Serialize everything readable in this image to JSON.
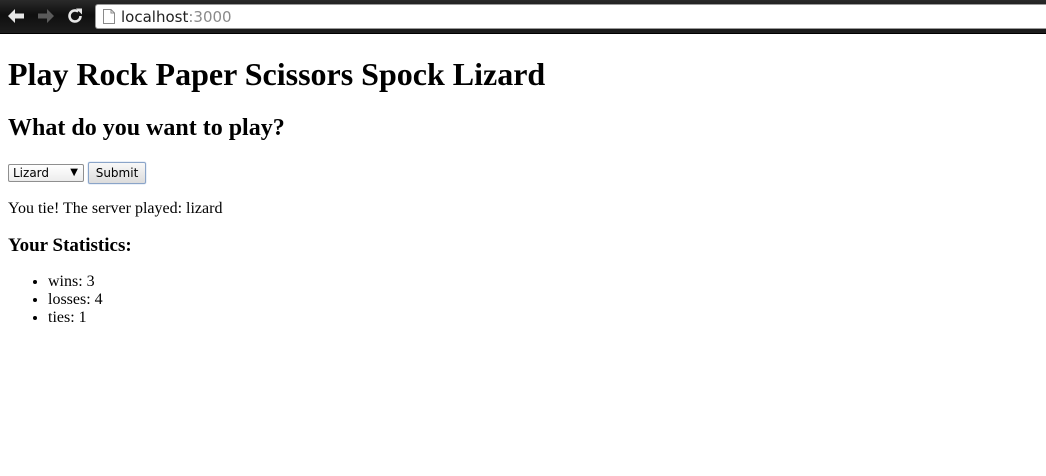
{
  "browser": {
    "url_host": "localhost",
    "url_port": ":3000"
  },
  "page": {
    "title": "Play Rock Paper Scissors Spock Lizard",
    "prompt": "What do you want to play?",
    "select_value": "Lizard",
    "submit_label": "Submit",
    "result_text": "You tie! The server played: lizard",
    "stats_heading": "Your Statistics:",
    "stats": [
      {
        "text": "wins: 3"
      },
      {
        "text": "losses: 4"
      },
      {
        "text": "ties: 1"
      }
    ]
  },
  "icons": {
    "back": "back-arrow-icon",
    "forward": "forward-arrow-icon",
    "reload": "reload-icon",
    "page": "page-icon",
    "dropdown": "chevron-down-icon"
  }
}
